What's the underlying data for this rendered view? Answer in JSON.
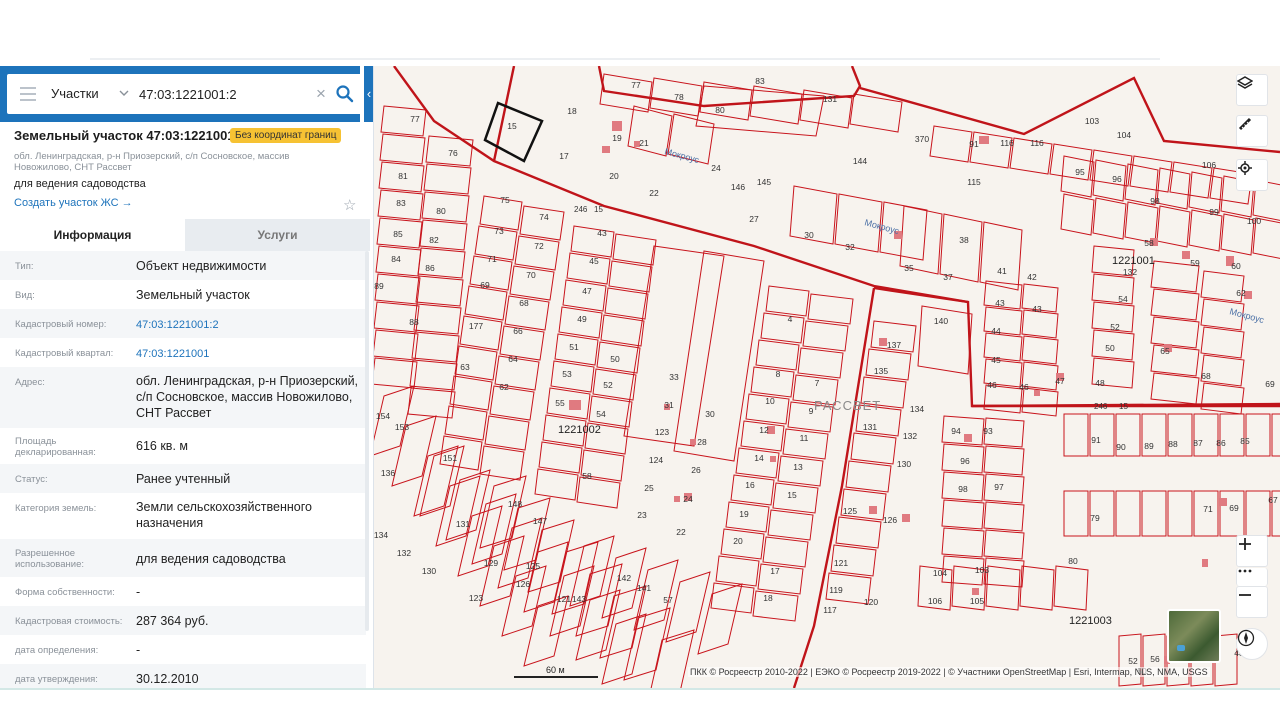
{
  "search": {
    "type_label": "Участки",
    "value": "47:03:1221001:2"
  },
  "parcel": {
    "title": "Земельный участок 47:03:1221001:2",
    "badge": "Без координат границ",
    "address_short": "обл. Ленинградская, р-н Приозерский, с/п Сосновское, массив Новожилово, СНТ Рассвет",
    "purpose": "для ведения садоводства",
    "create_link": "Создать участок ЖС"
  },
  "tabs": {
    "info": "Информация",
    "services": "Услуги"
  },
  "details": [
    {
      "label": "Тип:",
      "value": "Объект недвижимости"
    },
    {
      "label": "Вид:",
      "value": "Земельный участок"
    },
    {
      "label": "Кадастровый номер:",
      "value": "47:03:1221001:2"
    },
    {
      "label": "Кадастровый квартал:",
      "value": "47:03:1221001"
    },
    {
      "label": "Адрес:",
      "value": "обл. Ленинградская, р-н Приозерский, с/п Сосновское, массив Новожилово, СНТ Рассвет"
    },
    {
      "label": "Площадь декларированная:",
      "value": "616 кв. м"
    },
    {
      "label": "Статус:",
      "value": "Ранее учтенный"
    },
    {
      "label": "Категория земель:",
      "value": "Земли сельскохозяйственного назначения"
    },
    {
      "label": "Разрешенное использование:",
      "value": "для ведения садоводства"
    },
    {
      "label": "Форма собственности:",
      "value": "-"
    },
    {
      "label": "Кадастровая стоимость:",
      "value": "287 364 руб."
    },
    {
      "label": "дата определения:",
      "value": "-"
    },
    {
      "label": "дата утверждения:",
      "value": "30.12.2010"
    }
  ],
  "map": {
    "snt_label": "РАССВЕТ",
    "street_labels": [
      "Мокроус",
      "Мокроус",
      "Мокроус"
    ],
    "quarter_labels": [
      "1221001",
      "1221002",
      "1221003"
    ],
    "road_label_a": "246",
    "road_label_b": "15",
    "parcel_numbers": [
      "77",
      "78",
      "80",
      "83",
      "131",
      "144",
      "370",
      "91",
      "116",
      "116",
      "103",
      "104",
      "95",
      "96",
      "106",
      "98",
      "99",
      "100",
      "18",
      "15",
      "17",
      "19",
      "21",
      "20",
      "22",
      "24",
      "146",
      "145",
      "27",
      "115",
      "77",
      "76",
      "81",
      "83",
      "80",
      "85",
      "82",
      "84",
      "86",
      "89",
      "88",
      "75",
      "74",
      "73",
      "72",
      "71",
      "70",
      "69",
      "68",
      "177",
      "66",
      "64",
      "63",
      "62",
      "43",
      "45",
      "47",
      "49",
      "51",
      "50",
      "53",
      "52",
      "55",
      "54",
      "58",
      "30",
      "32",
      "35",
      "37",
      "38",
      "58",
      "132",
      "59",
      "60",
      "62",
      "54",
      "52",
      "50",
      "65",
      "68",
      "41",
      "42",
      "43",
      "43",
      "44",
      "45",
      "46",
      "46",
      "47",
      "48",
      "4",
      "8",
      "7",
      "10",
      "9",
      "12",
      "11",
      "14",
      "13",
      "16",
      "15",
      "19",
      "20",
      "17",
      "18",
      "33",
      "31",
      "30",
      "123",
      "28",
      "124",
      "26",
      "25",
      "24",
      "23",
      "22",
      "137",
      "135",
      "134",
      "131",
      "132",
      "130",
      "140",
      "125",
      "126",
      "121",
      "119",
      "120",
      "117",
      "94",
      "93",
      "96",
      "98",
      "97",
      "104",
      "103",
      "106",
      "105",
      "91",
      "90",
      "89",
      "88",
      "87",
      "86",
      "85",
      "79",
      "80",
      "71",
      "69",
      "154",
      "153",
      "136",
      "151",
      "131",
      "148",
      "147",
      "134",
      "132",
      "130",
      "129",
      "125",
      "123",
      "126",
      "121",
      "143",
      "142",
      "141",
      "57",
      "56",
      "54",
      "52",
      "50",
      "48",
      "69",
      "67"
    ],
    "scale_label": "60 м",
    "attribution": "ПКК © Росреестр 2010-2022 | ЕЭКО © Росреестр 2019-2022 | © Участники OpenStreetMap | Esri, Intermap, NLS, NMA, USGS"
  },
  "colors": {
    "brand_blue": "#1d73bb",
    "badge_yellow": "#f6c233",
    "parcel_red": "#c8141c",
    "building_pink": "#e07a80"
  }
}
